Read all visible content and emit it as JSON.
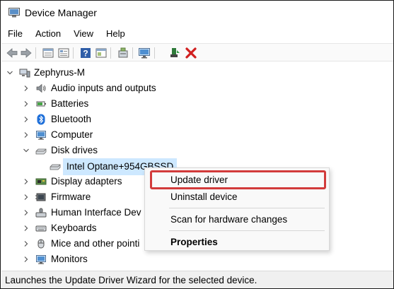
{
  "window": {
    "title": "Device Manager"
  },
  "menu": [
    "File",
    "Action",
    "View",
    "Help"
  ],
  "toolbar": {
    "buttons": [
      "back-icon",
      "forward-icon",
      "device-view-icon",
      "properties-icon",
      "help-icon",
      "action-view-icon",
      "scan-hardware-icon",
      "monitor-icon",
      "update-driver-icon",
      "uninstall-icon"
    ]
  },
  "tree": {
    "root": "Zephyrus-M",
    "items": [
      {
        "label": "Audio inputs and outputs",
        "icon": "speaker-icon"
      },
      {
        "label": "Batteries",
        "icon": "battery-icon"
      },
      {
        "label": "Bluetooth",
        "icon": "bluetooth-icon"
      },
      {
        "label": "Computer",
        "icon": "computer-icon"
      },
      {
        "label": "Disk drives",
        "icon": "disk-drive-icon"
      },
      {
        "label": "Intel Optane+954GBSSD",
        "icon": "disk-drive-icon"
      },
      {
        "label": "Display adapters",
        "icon": "display-adapter-icon"
      },
      {
        "label": "Firmware",
        "icon": "firmware-icon"
      },
      {
        "label": "Human Interface Dev",
        "icon": "hid-icon"
      },
      {
        "label": "Keyboards",
        "icon": "keyboard-icon"
      },
      {
        "label": "Mice and other pointi",
        "icon": "mouse-icon"
      },
      {
        "label": "Monitors",
        "icon": "monitor-icon"
      }
    ]
  },
  "context_menu": {
    "items": [
      "Update driver",
      "Uninstall device",
      "Scan for hardware changes",
      "Properties"
    ],
    "highlighted": "Update driver",
    "highlight_color": "#d23b3b"
  },
  "status": {
    "text": "Launches the Update Driver Wizard for the selected device."
  },
  "colors": {
    "selection": "#cde8ff",
    "red_x": "#d11f1f"
  }
}
